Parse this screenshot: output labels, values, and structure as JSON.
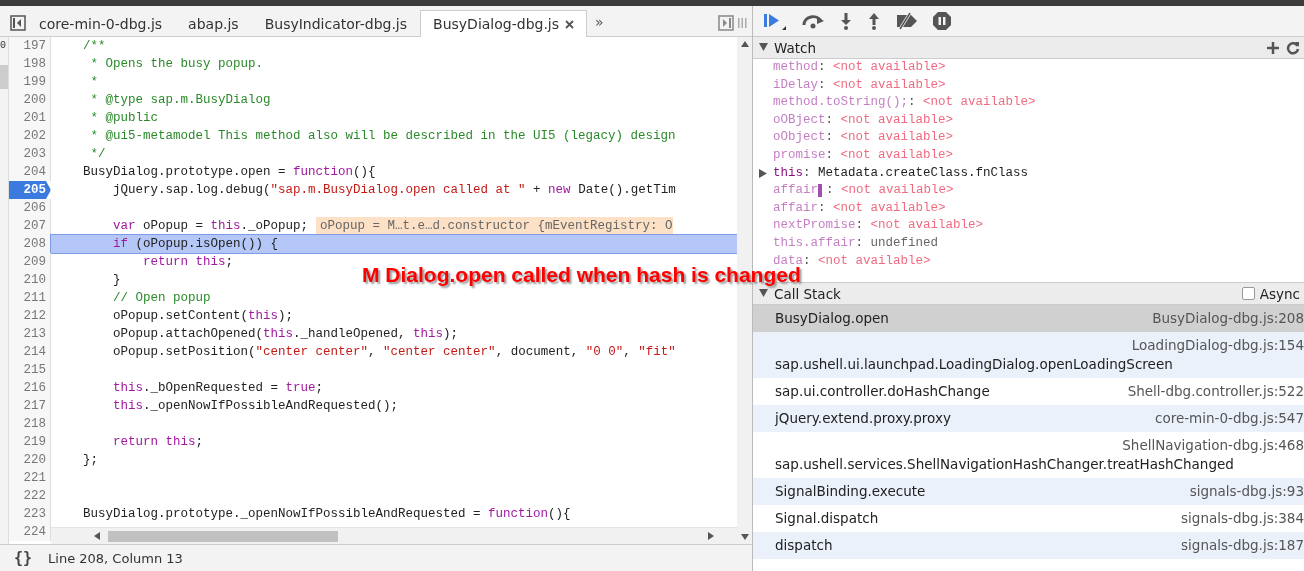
{
  "left_strip_text": "0",
  "tabs": [
    {
      "label": "core-min-0-dbg.js",
      "selected": false
    },
    {
      "label": "abap.js",
      "selected": false
    },
    {
      "label": "BusyIndicator-dbg.js",
      "selected": false
    },
    {
      "label": "BusyDialog-dbg.js",
      "selected": true,
      "closable": true
    }
  ],
  "tab_overflow": "»",
  "code": {
    "lines": [
      {
        "number": "197",
        "segments": [
          {
            "kind": "comment",
            "text": "    /**"
          }
        ]
      },
      {
        "number": "198",
        "segments": [
          {
            "kind": "comment",
            "text": "     * Opens the busy popup."
          }
        ]
      },
      {
        "number": "199",
        "segments": [
          {
            "kind": "comment",
            "text": "     *"
          }
        ]
      },
      {
        "number": "200",
        "segments": [
          {
            "kind": "comment",
            "text": "     * @type sap.m.BusyDialog"
          }
        ]
      },
      {
        "number": "201",
        "segments": [
          {
            "kind": "comment",
            "text": "     * @public"
          }
        ]
      },
      {
        "number": "202",
        "segments": [
          {
            "kind": "comment",
            "text": "     * @ui5-metamodel This method also will be described in the UI5 (legacy) design"
          }
        ]
      },
      {
        "number": "203",
        "segments": [
          {
            "kind": "comment",
            "text": "     */"
          }
        ]
      },
      {
        "number": "204",
        "segments": [
          {
            "kind": "plain",
            "text": "    BusyDialog.prototype.open = "
          },
          {
            "kind": "keyword",
            "text": "function"
          },
          {
            "kind": "plain",
            "text": "(){"
          }
        ]
      },
      {
        "number": "205",
        "breakpoint": true,
        "segments": [
          {
            "kind": "plain",
            "text": "        jQuery.sap.log.debug("
          },
          {
            "kind": "string",
            "text": "\"sap.m.BusyDialog.open called at \""
          },
          {
            "kind": "plain",
            "text": " + "
          },
          {
            "kind": "keyword",
            "text": "new"
          },
          {
            "kind": "plain",
            "text": " Date().getTim"
          }
        ]
      },
      {
        "number": "206"
      },
      {
        "number": "207",
        "segments": [
          {
            "kind": "keyword",
            "text": "        var"
          },
          {
            "kind": "plain",
            "text": " oPopup = "
          },
          {
            "kind": "keyword",
            "text": "this"
          },
          {
            "kind": "plain",
            "text": "._oPopup;"
          }
        ],
        "inline_value": "oPopup = M…t.e…d.constructor {mEventRegistry: O"
      },
      {
        "number": "208",
        "current": true,
        "segments": [
          {
            "kind": "keyword",
            "text": "        if"
          },
          {
            "kind": "plain",
            "text": " (oPopup.isOpen()) {"
          }
        ]
      },
      {
        "number": "209",
        "segments": [
          {
            "kind": "keyword",
            "text": "            return this"
          },
          {
            "kind": "plain",
            "text": ";"
          }
        ]
      },
      {
        "number": "210",
        "segments": [
          {
            "kind": "plain",
            "text": "        }"
          }
        ]
      },
      {
        "number": "211",
        "segments": [
          {
            "kind": "comment",
            "text": "        // Open popup"
          }
        ]
      },
      {
        "number": "212",
        "segments": [
          {
            "kind": "plain",
            "text": "        oPopup.setContent("
          },
          {
            "kind": "keyword",
            "text": "this"
          },
          {
            "kind": "plain",
            "text": ");"
          }
        ]
      },
      {
        "number": "213",
        "segments": [
          {
            "kind": "plain",
            "text": "        oPopup.attachOpened("
          },
          {
            "kind": "keyword",
            "text": "this"
          },
          {
            "kind": "plain",
            "text": "._handleOpened, "
          },
          {
            "kind": "keyword",
            "text": "this"
          },
          {
            "kind": "plain",
            "text": ");"
          }
        ]
      },
      {
        "number": "214",
        "segments": [
          {
            "kind": "plain",
            "text": "        oPopup.setPosition("
          },
          {
            "kind": "string",
            "text": "\"center center\""
          },
          {
            "kind": "plain",
            "text": ", "
          },
          {
            "kind": "string",
            "text": "\"center center\""
          },
          {
            "kind": "plain",
            "text": ", document, "
          },
          {
            "kind": "string",
            "text": "\"0 0\""
          },
          {
            "kind": "plain",
            "text": ", "
          },
          {
            "kind": "string",
            "text": "\"fit\""
          }
        ]
      },
      {
        "number": "215"
      },
      {
        "number": "216",
        "segments": [
          {
            "kind": "keyword",
            "text": "        this"
          },
          {
            "kind": "plain",
            "text": "._bOpenRequested = "
          },
          {
            "kind": "keyword",
            "text": "true"
          },
          {
            "kind": "plain",
            "text": ";"
          }
        ]
      },
      {
        "number": "217",
        "segments": [
          {
            "kind": "keyword",
            "text": "        this"
          },
          {
            "kind": "plain",
            "text": "._openNowIfPossibleAndRequested();"
          }
        ]
      },
      {
        "number": "218"
      },
      {
        "number": "219",
        "segments": [
          {
            "kind": "keyword",
            "text": "        return this"
          },
          {
            "kind": "plain",
            "text": ";"
          }
        ]
      },
      {
        "number": "220",
        "segments": [
          {
            "kind": "plain",
            "text": "    };"
          }
        ]
      },
      {
        "number": "221"
      },
      {
        "number": "222"
      },
      {
        "number": "223",
        "segments": [
          {
            "kind": "plain",
            "text": "    BusyDialog.prototype._openNowIfPossibleAndRequested = "
          },
          {
            "kind": "keyword",
            "text": "function"
          },
          {
            "kind": "plain",
            "text": "(){"
          }
        ]
      },
      {
        "number": "224"
      }
    ]
  },
  "annotation": "M Dialog.open called when hash is changed",
  "status_bar": {
    "format_button": "{}",
    "position": "Line 208, Column 13"
  },
  "watch": {
    "title": "Watch",
    "expanded": true,
    "items": [
      {
        "name": "method",
        "separator": ":",
        "value": "<not available>",
        "kind": "na"
      },
      {
        "name": "iDelay",
        "separator": ":",
        "value": "<not available>",
        "kind": "na"
      },
      {
        "name": "method.toString();",
        "separator": ":",
        "value": "<not available>",
        "kind": "na"
      },
      {
        "name": "oOBject",
        "separator": ":",
        "value": "<not available>",
        "kind": "na"
      },
      {
        "name": "oObject",
        "separator": ":",
        "value": "<not available>",
        "kind": "na"
      },
      {
        "name": "promise",
        "separator": ":",
        "value": "<not available>",
        "kind": "na"
      },
      {
        "name": "this",
        "separator": ":",
        "value": "Metadata.createClass.fnClass",
        "kind": "object",
        "expandable": true
      },
      {
        "name": "affair",
        "separator": ":",
        "value": "<not available>",
        "kind": "na",
        "editing": true
      },
      {
        "name": "affair",
        "separator": ":",
        "value": "<not available>",
        "kind": "na"
      },
      {
        "name": "nextPromise",
        "separator": ":",
        "value": "<not available>",
        "kind": "na"
      },
      {
        "name": "this.affair",
        "separator": ":",
        "value": "undefined",
        "kind": "undefined"
      },
      {
        "name": "data",
        "separator": ":",
        "value": "<not available>",
        "kind": "na"
      }
    ]
  },
  "call_stack": {
    "title": "Call Stack",
    "expanded": true,
    "async_label": "Async",
    "async_checked": false,
    "frames": [
      {
        "function": "BusyDialog.open",
        "location": "BusyDialog-dbg.js:208",
        "selected": true
      },
      {
        "function": "sap.ushell.ui.launchpad.LoadingDialog.openLoadingScreen",
        "location": "LoadingDialog-dbg.js:154",
        "selected": false
      },
      {
        "function": "sap.ui.controller.doHashChange",
        "location": "Shell-dbg.controller.js:522",
        "selected": false
      },
      {
        "function": "jQuery.extend.proxy.proxy",
        "location": "core-min-0-dbg.js:547",
        "selected": false
      },
      {
        "function": "sap.ushell.services.ShellNavigationHashChanger.treatHashChanged",
        "location": "ShellNavigation-dbg.js:468",
        "selected": false
      },
      {
        "function": "SignalBinding.execute",
        "location": "signals-dbg.js:93",
        "selected": false
      },
      {
        "function": "Signal.dispatch",
        "location": "signals-dbg.js:384",
        "selected": false
      },
      {
        "function": "dispatch",
        "location": "signals-dbg.js:187",
        "selected": false
      }
    ]
  }
}
